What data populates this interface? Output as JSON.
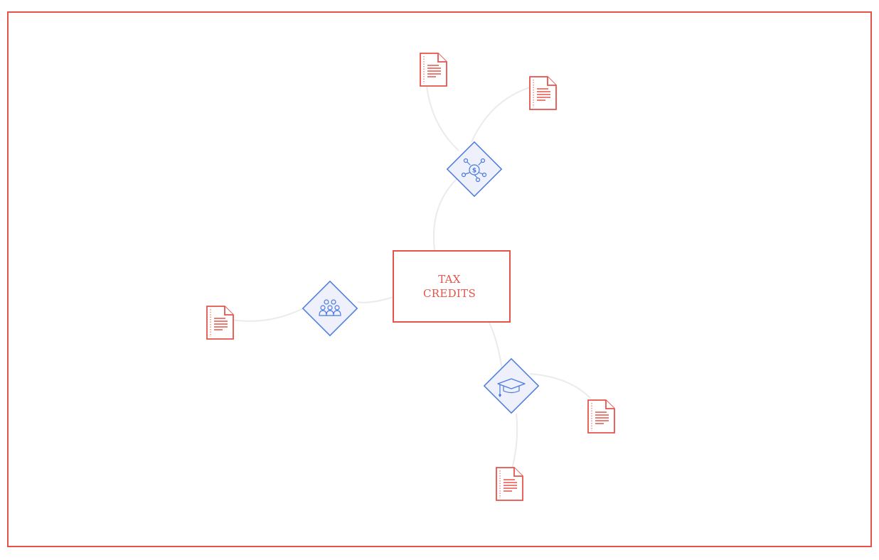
{
  "center": {
    "line1": "TAX",
    "line2": "CREDITS"
  },
  "colors": {
    "accent": "#e5534b",
    "hub": "#4a7ae0",
    "hub_fill": "#eef0fb",
    "link": "#ebebeb"
  },
  "hubs": [
    {
      "id": "finance",
      "icon": "dollar-network-icon"
    },
    {
      "id": "community",
      "icon": "people-group-icon"
    },
    {
      "id": "education",
      "icon": "graduation-cap-icon"
    }
  ],
  "documents": [
    {
      "hub": "finance",
      "icon": "document-icon"
    },
    {
      "hub": "finance",
      "icon": "document-icon"
    },
    {
      "hub": "community",
      "icon": "document-icon"
    },
    {
      "hub": "education",
      "icon": "document-icon"
    },
    {
      "hub": "education",
      "icon": "document-icon"
    }
  ]
}
